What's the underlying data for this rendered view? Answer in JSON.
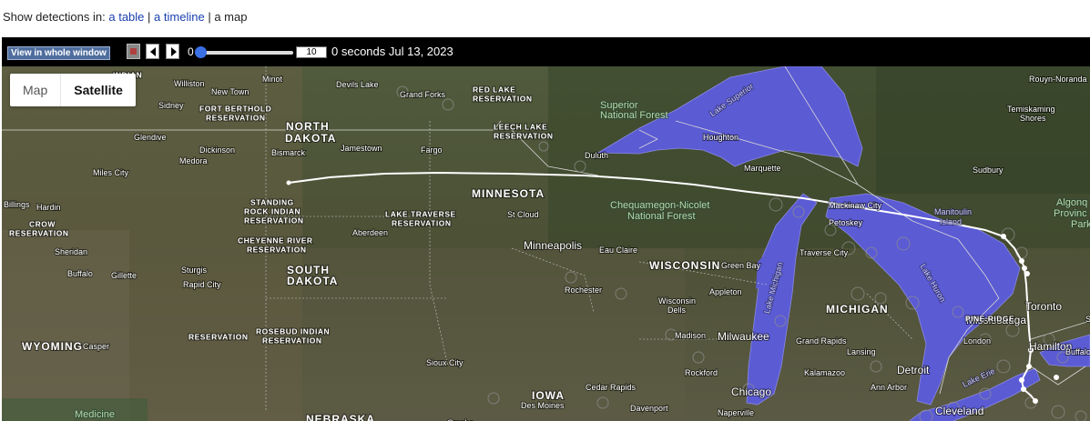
{
  "header": {
    "prefix": "Show detections in:",
    "link_table": "a table",
    "sep1": "|",
    "link_timeline": "a timeline",
    "sep2": "|",
    "current_view": "a map"
  },
  "toolbar": {
    "whole_window_label": "View in whole window",
    "slider_min": "0",
    "step_value": "10",
    "status": "0 seconds Jul 13, 2023"
  },
  "map_type": {
    "map_label": "Map",
    "satellite_label": "Satellite"
  },
  "map": {
    "labels": [
      {
        "text": "INDIAN",
        "cls": "res"
      },
      {
        "text": "Williston",
        "cls": "town"
      },
      {
        "text": "Minot",
        "cls": "town"
      },
      {
        "text": "Devils Lake",
        "cls": "town"
      },
      {
        "text": "Grand Forks",
        "cls": "town"
      },
      {
        "text": "RED LAKE",
        "cls": "res"
      },
      {
        "text": "RESERVATION",
        "cls": "res"
      },
      {
        "text": "Superior",
        "cls": "park"
      },
      {
        "text": "National Forest",
        "cls": "park"
      },
      {
        "text": "Lake Superior",
        "cls": "water"
      },
      {
        "text": "Rouyn-Noranda",
        "cls": "town"
      },
      {
        "text": "New Town",
        "cls": "town"
      },
      {
        "text": "Sidney",
        "cls": "town"
      },
      {
        "text": "FORT BERTHOLD",
        "cls": "res"
      },
      {
        "text": "RESERVATION",
        "cls": "res"
      },
      {
        "text": "NORTH",
        "cls": "state"
      },
      {
        "text": "DAKOTA",
        "cls": "state"
      },
      {
        "text": "LEECH LAKE",
        "cls": "res"
      },
      {
        "text": "RESERVATION",
        "cls": "res"
      },
      {
        "text": "Houghton",
        "cls": "town"
      },
      {
        "text": "Temiskaming",
        "cls": "town"
      },
      {
        "text": "Shores",
        "cls": "town"
      },
      {
        "text": "Glendive",
        "cls": "town"
      },
      {
        "text": "Dickinson",
        "cls": "town"
      },
      {
        "text": "Medora",
        "cls": "town"
      },
      {
        "text": "Bismarck",
        "cls": "town"
      },
      {
        "text": "Jamestown",
        "cls": "town"
      },
      {
        "text": "Fargo",
        "cls": "town"
      },
      {
        "text": "Duluth",
        "cls": "town"
      },
      {
        "text": "Marquette",
        "cls": "town"
      },
      {
        "text": "Sudbury",
        "cls": "town"
      },
      {
        "text": "Miles City",
        "cls": "town"
      },
      {
        "text": "MINNESOTA",
        "cls": "state"
      },
      {
        "text": "Mackinaw City",
        "cls": "town"
      },
      {
        "text": "Manitoulin",
        "cls": "water"
      },
      {
        "text": "Island",
        "cls": "water"
      },
      {
        "text": "Algonq",
        "cls": "park"
      },
      {
        "text": "Provinc",
        "cls": "park"
      },
      {
        "text": "Park",
        "cls": "park"
      },
      {
        "text": "Billings",
        "cls": "town"
      },
      {
        "text": "Hardin",
        "cls": "town"
      },
      {
        "text": "STANDING",
        "cls": "res"
      },
      {
        "text": "ROCK INDIAN",
        "cls": "res"
      },
      {
        "text": "RESERVATION",
        "cls": "res"
      },
      {
        "text": "LAKE TRAVERSE",
        "cls": "res"
      },
      {
        "text": "RESERVATION",
        "cls": "res"
      },
      {
        "text": "St Cloud",
        "cls": "town"
      },
      {
        "text": "Chequamegon-Nicolet",
        "cls": "park"
      },
      {
        "text": "National Forest",
        "cls": "park"
      },
      {
        "text": "Petoskey",
        "cls": "town"
      },
      {
        "text": "CROW",
        "cls": "res"
      },
      {
        "text": "RESERVATION",
        "cls": "res"
      },
      {
        "text": "Aberdeen",
        "cls": "town"
      },
      {
        "text": "CHEYENNE RIVER",
        "cls": "res"
      },
      {
        "text": "RESERVATION",
        "cls": "res"
      },
      {
        "text": "Minneapolis",
        "cls": "city"
      },
      {
        "text": "Eau Claire",
        "cls": "town"
      },
      {
        "text": "Traverse City",
        "cls": "town"
      },
      {
        "text": "Lake Huron",
        "cls": "water"
      },
      {
        "text": "Sheridan",
        "cls": "town"
      },
      {
        "text": "WISCONSIN",
        "cls": "state"
      },
      {
        "text": "Green Bay",
        "cls": "town"
      },
      {
        "text": "Buffalo",
        "cls": "town"
      },
      {
        "text": "Gillette",
        "cls": "town"
      },
      {
        "text": "Sturgis",
        "cls": "town"
      },
      {
        "text": "SOUTH",
        "cls": "state"
      },
      {
        "text": "DAKOTA",
        "cls": "state"
      },
      {
        "text": "Rapid City",
        "cls": "town"
      },
      {
        "text": "Rochester",
        "cls": "town"
      },
      {
        "text": "Appleton",
        "cls": "town"
      },
      {
        "text": "Lake Michigan",
        "cls": "water"
      },
      {
        "text": "Wisconsin",
        "cls": "town"
      },
      {
        "text": "Dells",
        "cls": "town"
      },
      {
        "text": "MICHIGAN",
        "cls": "state"
      },
      {
        "text": "Toronto",
        "cls": "city"
      },
      {
        "text": "Sioux Falls",
        "cls": "town"
      },
      {
        "text": "Mississauga",
        "cls": "city"
      },
      {
        "text": "PINE RIDGE",
        "cls": "res"
      },
      {
        "text": "RESERVATION",
        "cls": "res"
      },
      {
        "text": "ROSEBUD INDIAN",
        "cls": "res"
      },
      {
        "text": "RESERVATION",
        "cls": "res"
      },
      {
        "text": "Madison",
        "cls": "town"
      },
      {
        "text": "Milwaukee",
        "cls": "city"
      },
      {
        "text": "Grand Rapids",
        "cls": "town"
      },
      {
        "text": "London",
        "cls": "town"
      },
      {
        "text": "Hamilton",
        "cls": "city"
      },
      {
        "text": "WYOMING",
        "cls": "state"
      },
      {
        "text": "Casper",
        "cls": "town"
      },
      {
        "text": "Lansing",
        "cls": "town"
      },
      {
        "text": "Buffalo",
        "cls": "town"
      },
      {
        "text": "Sioux City",
        "cls": "town"
      },
      {
        "text": "Rockford",
        "cls": "town"
      },
      {
        "text": "Kalamazoo",
        "cls": "town"
      },
      {
        "text": "Detroit",
        "cls": "city"
      },
      {
        "text": "IOWA",
        "cls": "state"
      },
      {
        "text": "Cedar Rapids",
        "cls": "town"
      },
      {
        "text": "Chicago",
        "cls": "city"
      },
      {
        "text": "Ann Arbor",
        "cls": "town"
      },
      {
        "text": "Lake Erie",
        "cls": "water"
      },
      {
        "text": "Des Moines",
        "cls": "town"
      },
      {
        "text": "Davenport",
        "cls": "town"
      },
      {
        "text": "Cleveland",
        "cls": "city"
      },
      {
        "text": "Medicine",
        "cls": "park"
      },
      {
        "text": "Bow-Routt",
        "cls": "park"
      },
      {
        "text": "NEBRASKA",
        "cls": "state"
      },
      {
        "text": "Omaha",
        "cls": "town"
      },
      {
        "text": "Naperville",
        "cls": "town"
      }
    ]
  },
  "colors": {
    "land": "#4a5238",
    "water": "#5b5bd4",
    "track": "#ffffff",
    "toolbar": "#000000"
  }
}
